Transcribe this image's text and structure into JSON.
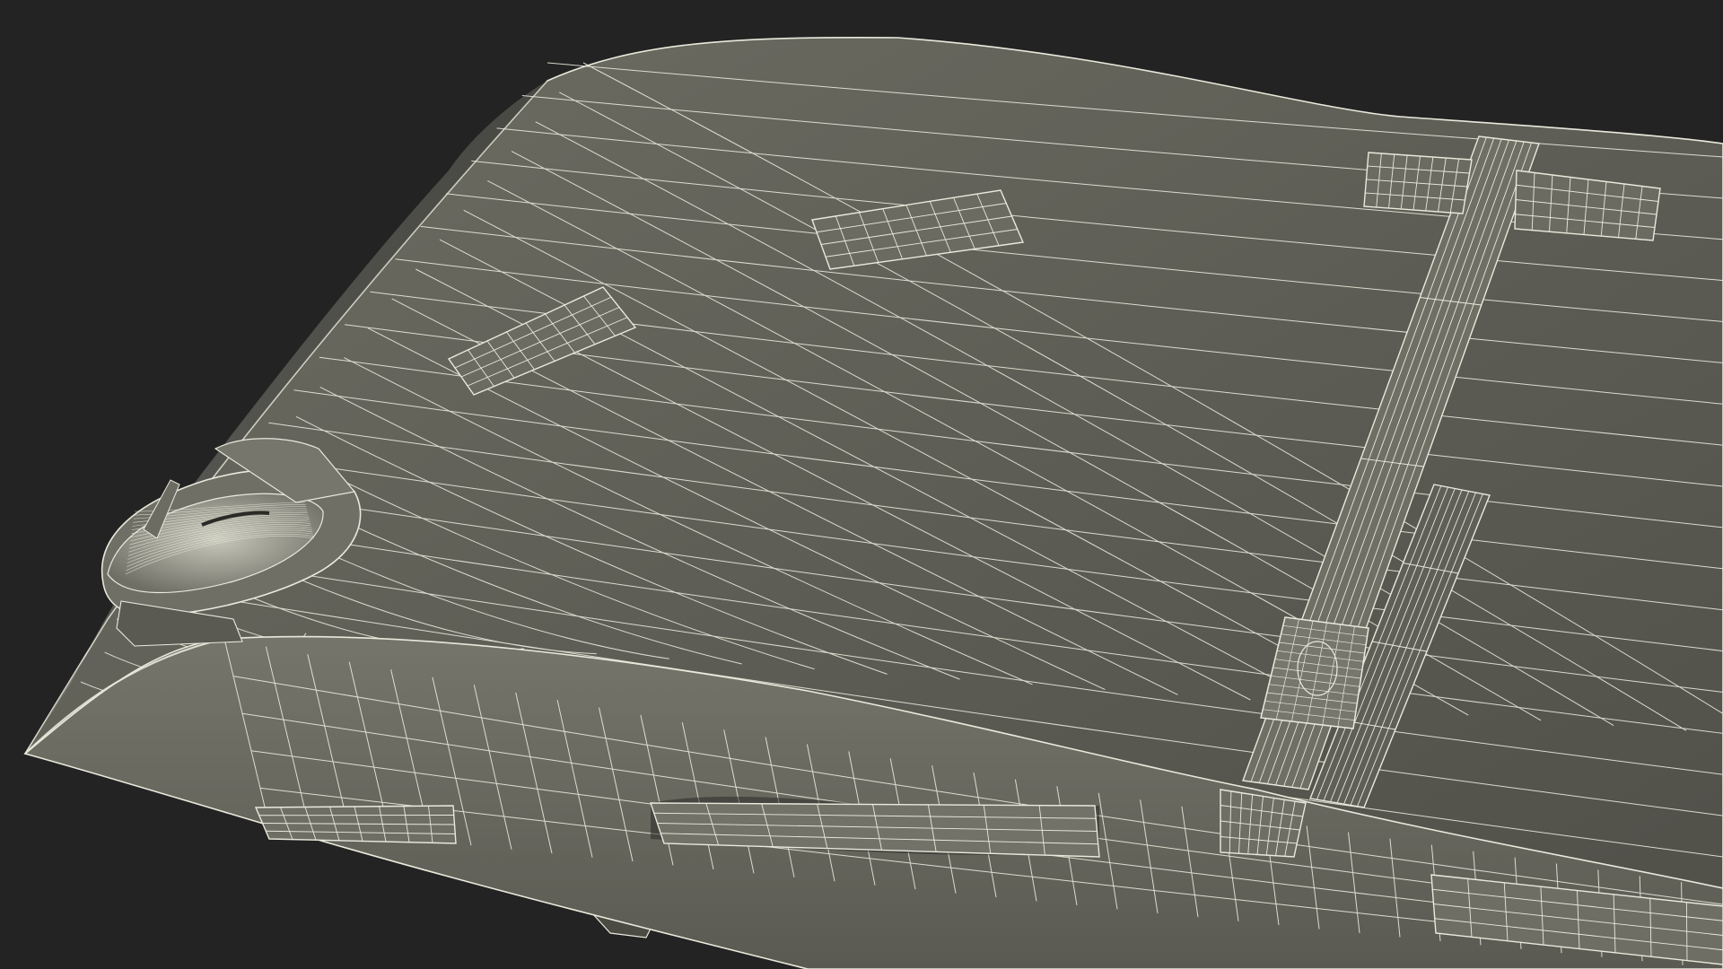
{
  "scene": {
    "subject": "rescue-basket-stretcher-wireframe",
    "render_mode": "wireframe-over-solid",
    "parts": [
      {
        "name": "basket-floor",
        "kind": "mesh-surface"
      },
      {
        "name": "basket-side-rail",
        "kind": "mesh-surface"
      },
      {
        "name": "center-strap",
        "kind": "strap"
      },
      {
        "name": "side-strap",
        "kind": "strap"
      },
      {
        "name": "strap-loops",
        "kind": "loop"
      },
      {
        "name": "ratchet-buckle",
        "kind": "buckle"
      },
      {
        "name": "head-end-buckle",
        "kind": "buckle"
      },
      {
        "name": "under-tab",
        "kind": "tab"
      }
    ]
  },
  "colors": {
    "background": "#232323",
    "surface_base": "#636358",
    "surface_light": "#7a7a6f",
    "surface_dark": "#4d4d45",
    "rim_surface": "#6b6b61",
    "wire": "#e9e9dc",
    "buckle_fill": "#8a8a7e"
  }
}
